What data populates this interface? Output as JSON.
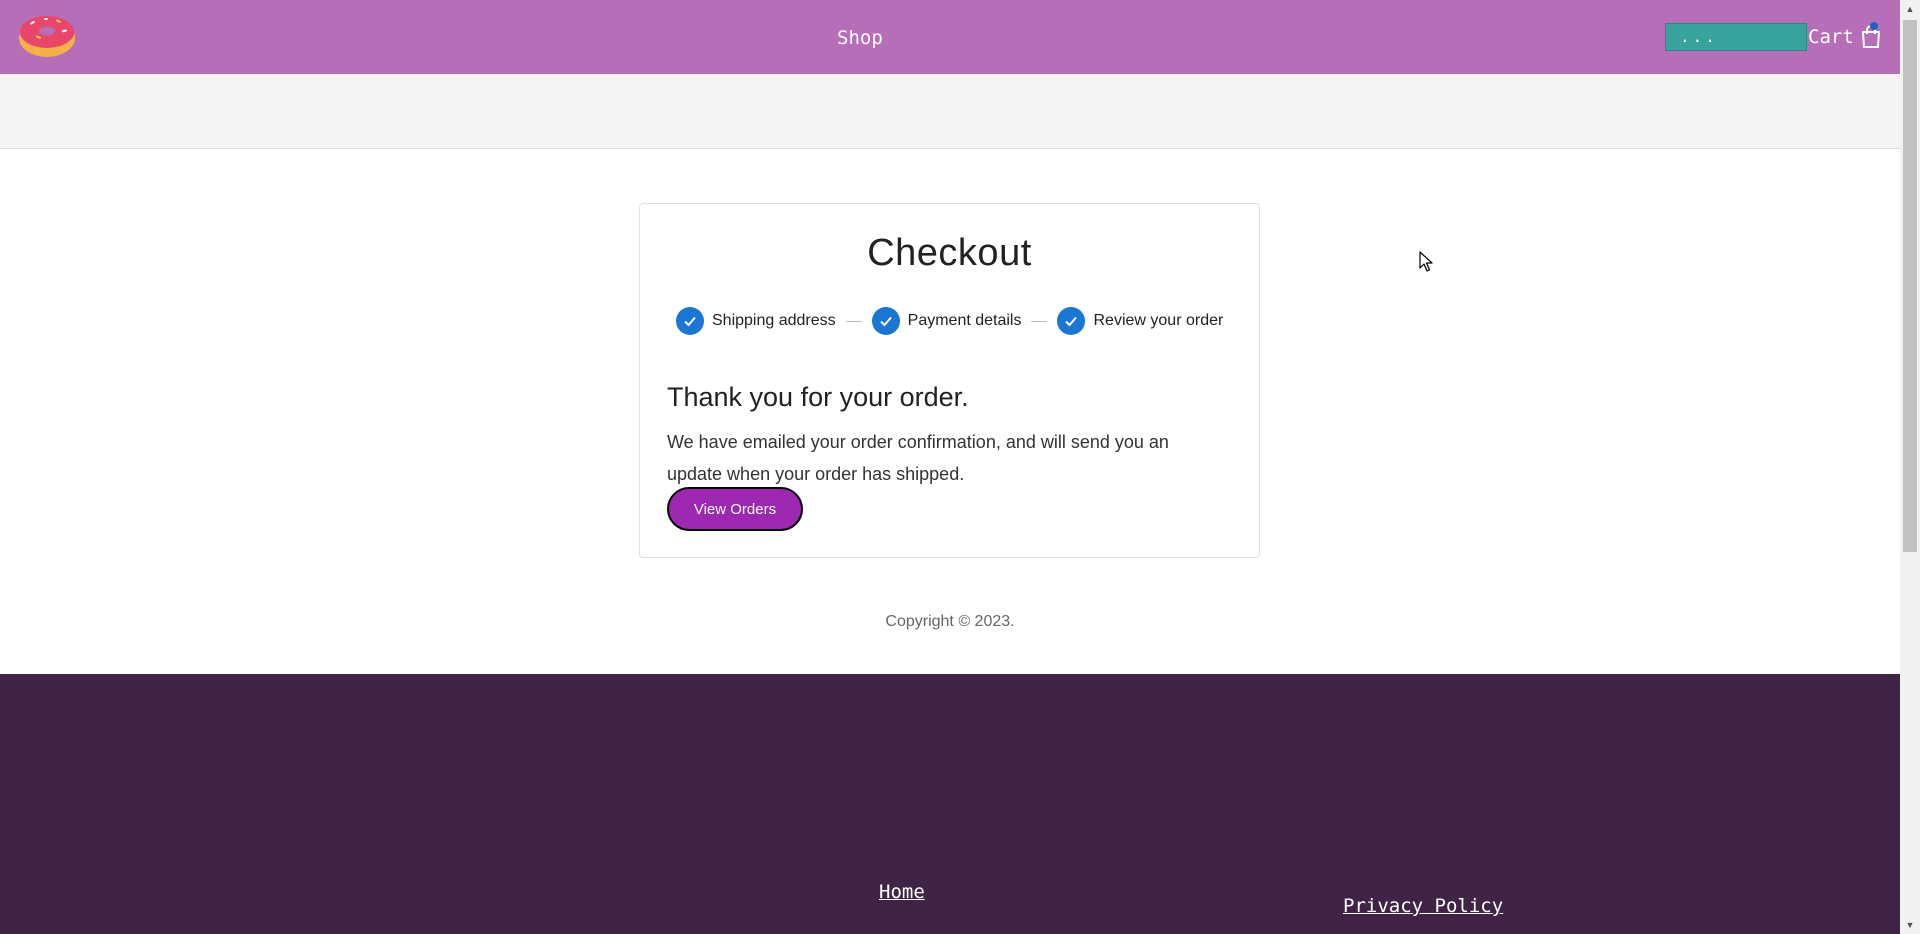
{
  "header": {
    "logo_icon": "donut-icon",
    "nav_shop": "Shop",
    "search_value": "...",
    "cart_label": "Cart",
    "cart_icon": "shopping-bag-icon"
  },
  "checkout": {
    "title": "Checkout",
    "steps": [
      {
        "label": "Shipping address",
        "state": "complete"
      },
      {
        "label": "Payment details",
        "state": "complete"
      },
      {
        "label": "Review your order",
        "state": "complete"
      }
    ],
    "thanks_heading": "Thank you for your order.",
    "message": "We have emailed your order confirmation, and will send you an update when your order has shipped.",
    "view_orders_label": "View Orders"
  },
  "copyright": "Copyright © 2023.",
  "footer": {
    "home_label": "Home",
    "privacy_label": "Privacy Policy"
  },
  "colors": {
    "header_bg": "#b66eb8",
    "accent_blue": "#1976d2",
    "button_purple": "#9c27b0",
    "footer_bg": "#3f2445",
    "search_bg": "#37a39c"
  }
}
